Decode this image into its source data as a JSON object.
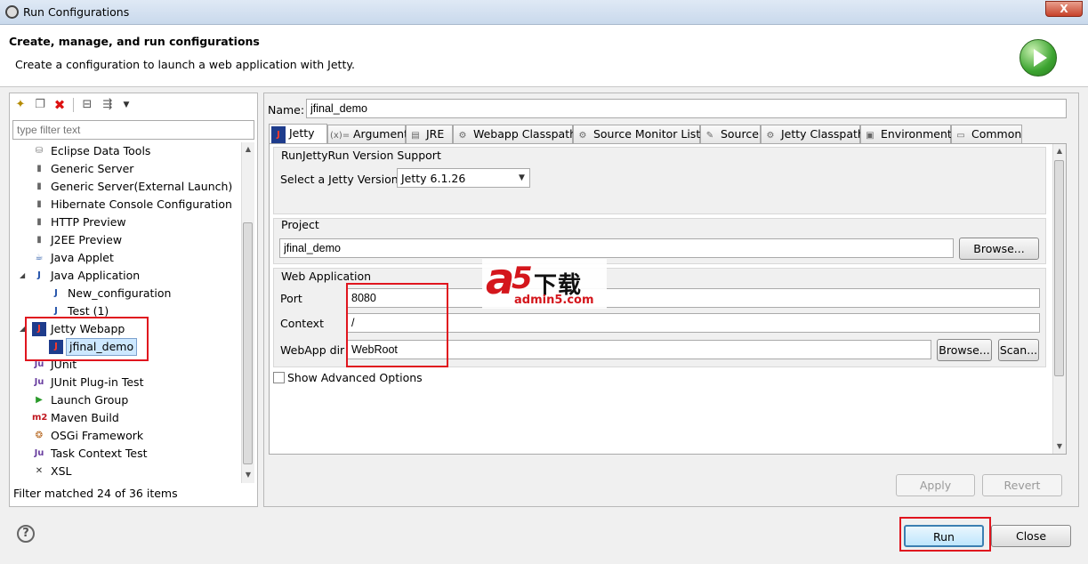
{
  "window": {
    "title": "Run Configurations",
    "close_label": "X"
  },
  "header": {
    "title": "Create, manage, and run configurations",
    "subtitle": "Create a configuration to launch a web application with Jetty."
  },
  "left": {
    "filter_placeholder": "type filter text",
    "tree": [
      {
        "label": "Eclipse Data Tools",
        "icon": "database-icon",
        "level": 1
      },
      {
        "label": "Generic Server",
        "icon": "server-icon",
        "level": 1
      },
      {
        "label": "Generic Server(External Launch)",
        "icon": "server-icon",
        "level": 1
      },
      {
        "label": "Hibernate Console Configuration",
        "icon": "server-icon",
        "level": 1
      },
      {
        "label": "HTTP Preview",
        "icon": "server-icon",
        "level": 1
      },
      {
        "label": "J2EE Preview",
        "icon": "server-icon",
        "level": 1
      },
      {
        "label": "Java Applet",
        "icon": "applet-icon",
        "level": 1
      },
      {
        "label": "Java Application",
        "icon": "java-app-icon",
        "level": 1,
        "expanded": true
      },
      {
        "label": "New_configuration",
        "icon": "java-app-icon",
        "level": 2
      },
      {
        "label": "Test (1)",
        "icon": "java-app-icon",
        "level": 2
      },
      {
        "label": "Jetty Webapp",
        "icon": "jetty-icon",
        "level": 1,
        "expanded": true
      },
      {
        "label": "jfinal_demo",
        "icon": "jetty-icon",
        "level": 2,
        "selected": true
      },
      {
        "label": "JUnit",
        "icon": "junit-icon",
        "level": 1
      },
      {
        "label": "JUnit Plug-in Test",
        "icon": "junit-icon",
        "level": 1
      },
      {
        "label": "Launch Group",
        "icon": "launch-group-icon",
        "level": 1
      },
      {
        "label": "Maven Build",
        "icon": "maven-icon",
        "level": 1
      },
      {
        "label": "OSGi Framework",
        "icon": "osgi-icon",
        "level": 1
      },
      {
        "label": "Task Context Test",
        "icon": "junit-icon",
        "level": 1
      },
      {
        "label": "XSL",
        "icon": "xsl-icon",
        "level": 1
      }
    ],
    "status": "Filter matched 24 of 36 items"
  },
  "right": {
    "name_label": "Name:",
    "name_value": "jfinal_demo",
    "tabs": [
      {
        "label": "Jetty",
        "icon": "jetty-icon",
        "active": true
      },
      {
        "label": "Arguments",
        "icon": "arguments-icon"
      },
      {
        "label": "JRE",
        "icon": "jre-icon"
      },
      {
        "label": "Webapp Classpath",
        "icon": "classpath-icon"
      },
      {
        "label": "Source Monitor List",
        "icon": "classpath-icon"
      },
      {
        "label": "Source",
        "icon": "source-icon"
      },
      {
        "label": "Jetty Classpath",
        "icon": "classpath-icon"
      },
      {
        "label": "Environment",
        "icon": "environment-icon"
      },
      {
        "label": "Common",
        "icon": "common-icon"
      }
    ],
    "support": {
      "group_label": "RunJettyRun Version Support",
      "select_label": "Select a Jetty Version:",
      "select_value": "Jetty 6.1.26"
    },
    "project": {
      "group_label": "Project",
      "value": "jfinal_demo",
      "browse": "Browse..."
    },
    "webapp": {
      "group_label": "Web Application",
      "port_label": "Port",
      "port_value": "8080",
      "context_label": "Context",
      "context_value": "/",
      "dir_label": "WebApp dir",
      "dir_value": "WebRoot",
      "browse": "Browse...",
      "scan": "Scan..."
    },
    "advanced_label": "Show Advanced Options",
    "apply": "Apply",
    "revert": "Revert"
  },
  "footer": {
    "run": "Run",
    "close": "Close",
    "help": "?"
  },
  "watermark": {
    "brand_a": "a",
    "brand_5": "5",
    "brand_cn": "下载",
    "url": "admin5.com"
  },
  "colors": {
    "highlight_red": "#e0151e",
    "selection": "#cde8ff",
    "run_green": "#3ca430"
  }
}
